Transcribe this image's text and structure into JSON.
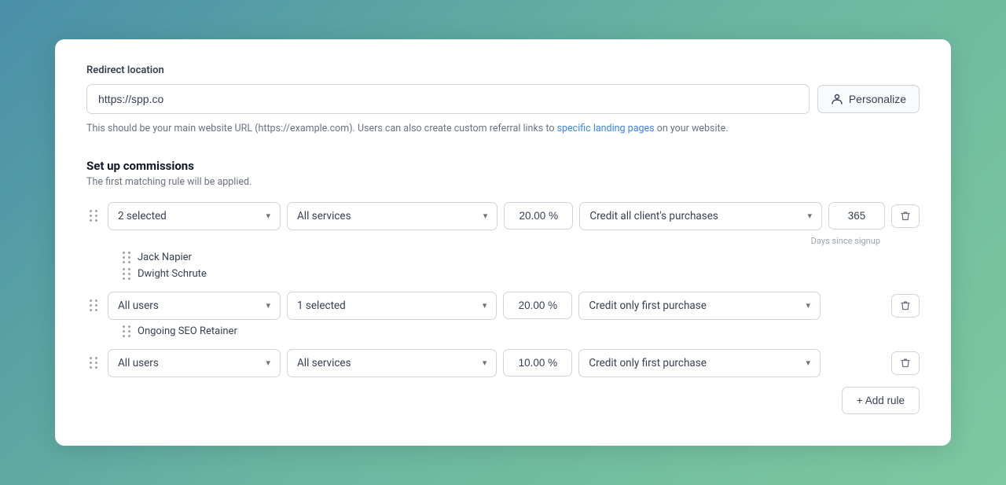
{
  "redirect": {
    "label": "Redirect location",
    "url_value": "https://spp.co",
    "url_placeholder": "https://spp.co",
    "personalize_label": "Personalize",
    "help_text_before": "This should be your main website URL (https://example.com). Users can also create custom referral links to ",
    "help_link_text": "specific landing pages",
    "help_text_after": " on your website."
  },
  "commissions": {
    "title": "Set up commissions",
    "subtitle": "The first matching rule will be applied.",
    "rules": [
      {
        "id": "rule-1",
        "users_label": "2 selected",
        "services_label": "All services",
        "percent": "20.00 %",
        "credit_label": "Credit all client's purchases",
        "days_value": "365",
        "days_since": "Days since signup",
        "expanded": true,
        "expanded_items": [
          "Jack Napier",
          "Dwight Schrute"
        ]
      },
      {
        "id": "rule-2",
        "users_label": "All users",
        "services_label": "1 selected",
        "percent": "20.00 %",
        "credit_label": "Credit only first purchase",
        "days_value": null,
        "days_since": null,
        "expanded": true,
        "expanded_items": [
          "Ongoing SEO Retainer"
        ]
      },
      {
        "id": "rule-3",
        "users_label": "All users",
        "services_label": "All services",
        "percent": "10.00 %",
        "credit_label": "Credit only first purchase",
        "days_value": null,
        "days_since": null,
        "expanded": false,
        "expanded_items": []
      }
    ],
    "add_rule_label": "+ Add rule"
  }
}
